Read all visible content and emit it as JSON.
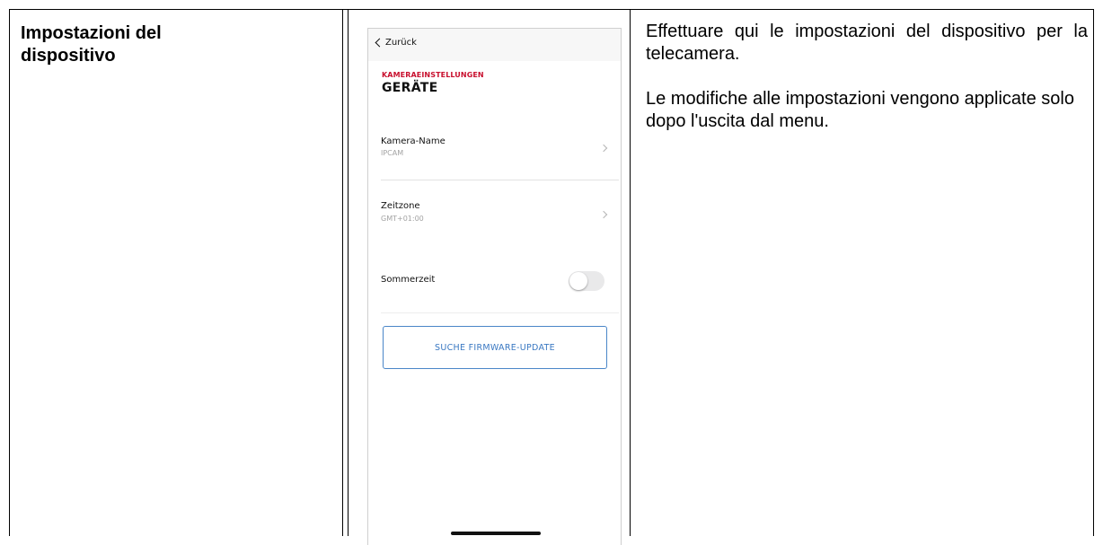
{
  "section": {
    "title_line1": "Impostazioni del",
    "title_line2": "dispositivo"
  },
  "description": {
    "paragraph1": "Effettuare qui le impostazioni del dispositivo per la telecamera.",
    "paragraph2": "Le modifiche alle impostazioni vengono applicate solo dopo l'uscita dal menu."
  },
  "phone": {
    "back_label": "Zurück",
    "kicker": "KAMERAEINSTELLUNGEN",
    "title": "GERÄTE",
    "rows": [
      {
        "label": "Kamera-Name",
        "value": "IPCAM"
      },
      {
        "label": "Zeitzone",
        "value": "GMT+01:00"
      }
    ],
    "dst": {
      "label": "Sommerzeit",
      "enabled": false
    },
    "firmware_button": "SUCHE FIRMWARE-UPDATE"
  },
  "colors": {
    "kicker": "#c8102e",
    "button_text": "#3a78c2",
    "button_border": "#4a86c8"
  },
  "icons": [
    "chevron-left-icon",
    "chevron-right-icon",
    "toggle-switch"
  ]
}
